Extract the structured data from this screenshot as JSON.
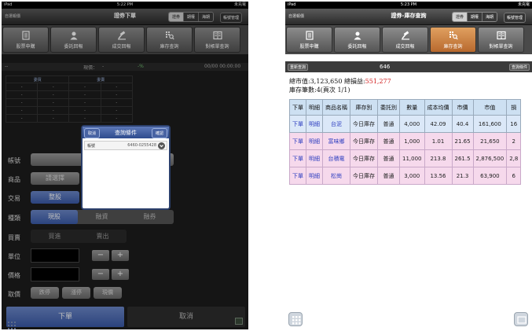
{
  "left": {
    "status": {
      "carrier": "iPad",
      "time": "5:22 PM",
      "right": "未充電"
    },
    "nav": {
      "left": "自選報價",
      "title": "證券下單",
      "seg": [
        "證券",
        "期權",
        "海期"
      ],
      "seg_active": 0,
      "btn": "帳號管理"
    },
    "tools": [
      {
        "label": "股票申購",
        "icon": "document-list-icon"
      },
      {
        "label": "委託回報",
        "icon": "person-icon"
      },
      {
        "label": "成交回報",
        "icon": "gavel-icon"
      },
      {
        "label": "庫存查詢",
        "icon": "grid-search-icon"
      },
      {
        "label": "對帳單查詢",
        "icon": "ledger-icon"
      }
    ],
    "quote": {
      "dash": "--",
      "price_label": "現價：",
      "price_value": "-",
      "pct": "-%",
      "time": "00/00 00:00:00"
    },
    "book": {
      "headers": [
        "委買",
        "委賣"
      ],
      "rows": [
        [
          "-",
          "-",
          "-",
          "-"
        ],
        [
          "-",
          "-",
          "-",
          "-"
        ],
        [
          "-",
          "-",
          "-",
          "-"
        ],
        [
          "-",
          "-",
          "-",
          "-"
        ],
        [
          "-",
          "-",
          "-",
          "-"
        ]
      ]
    },
    "form": {
      "account_label": "帳號",
      "product_label": "商品",
      "product_btn": "請選擇",
      "trade_label": "交易",
      "trade_btn": "整股",
      "type_label": "種類",
      "type_options": [
        "現股",
        "融資",
        "融券"
      ],
      "side_label": "買賣",
      "side_options": [
        "買進",
        "賣出"
      ],
      "unit_label": "單位",
      "price_label": "價格",
      "minus": "−",
      "plus": "+",
      "pick_label": "取價",
      "pick_options": [
        "跌停",
        "漲停",
        "現價"
      ]
    },
    "footer": {
      "order": "下單",
      "cancel": "取消"
    },
    "modal": {
      "title": "查詢條件",
      "cancel": "取消",
      "confirm": "確認",
      "row_label": "帳號",
      "row_value": "6460-0255428"
    }
  },
  "right": {
    "status": {
      "carrier": "iPad",
      "time": "5:23 PM",
      "right": "未充電"
    },
    "nav": {
      "left": "自選報價",
      "title": "證券-庫存查詢",
      "seg": [
        "證券",
        "期權",
        "海期"
      ],
      "seg_active": 0,
      "btn": "帳號管理"
    },
    "tools": [
      {
        "label": "股票申購",
        "icon": "document-list-icon"
      },
      {
        "label": "委託回報",
        "icon": "person-icon"
      },
      {
        "label": "成交回報",
        "icon": "gavel-icon"
      },
      {
        "label": "庫存查詢",
        "icon": "grid-search-icon"
      },
      {
        "label": "對帳單查詢",
        "icon": "ledger-icon"
      }
    ],
    "active_tool": 3,
    "subbar": {
      "left": "重新查詢",
      "center": "646",
      "right": "查詢條件"
    },
    "summary": {
      "line1_prefix": "總市值:3,123,650 總損益:",
      "line1_value": "551,277",
      "line2": "庫存筆數:4(頁次 1/1)"
    },
    "accent_red": "#d11f1f",
    "table": {
      "headers": [
        "下單",
        "明細",
        "商品名稱",
        "庫存別",
        "委託別",
        "數量",
        "成本均價",
        "市價",
        "市值",
        "損"
      ],
      "rows": [
        [
          "下單",
          "明細",
          "台泥",
          "今日庫存",
          "普通",
          "4,000",
          "42.09",
          "40.4",
          "161,600",
          "16"
        ],
        [
          "下單",
          "明細",
          "富味鄉",
          "今日庫存",
          "普通",
          "1,000",
          "1.01",
          "21.65",
          "21,650",
          "2"
        ],
        [
          "下單",
          "明細",
          "台積電",
          "今日庫存",
          "普通",
          "11,000",
          "213.8",
          "261.5",
          "2,876,500",
          "2,8"
        ],
        [
          "下單",
          "明細",
          "松崗",
          "今日庫存",
          "普通",
          "3,000",
          "13.56",
          "21.3",
          "63,900",
          "6"
        ]
      ]
    }
  }
}
